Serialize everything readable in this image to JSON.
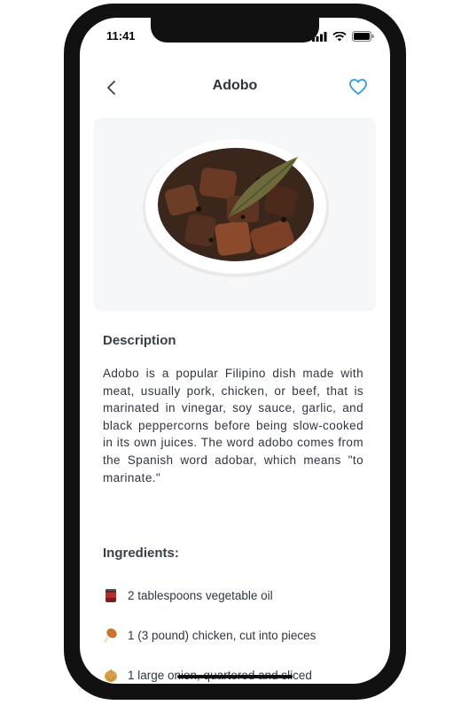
{
  "status": {
    "time": "11:41",
    "icons": [
      "signal-icon",
      "wifi-icon",
      "battery-icon"
    ]
  },
  "nav": {
    "title": "Adobo",
    "back_icon": "chevron-left-icon",
    "favorite_icon": "heart-outline-icon",
    "accent_color": "#2f9be8"
  },
  "hero": {
    "image": "adobo-dish-photo"
  },
  "description": {
    "heading": "Description",
    "body": "Adobo is a popular Filipino dish made with meat, usually pork, chicken, or beef, that is marinated in vinegar, soy sauce, garlic, and black peppercorns before being slow-cooked in its own juices. The word adobo comes from the Spanish word adobar, which means \"to marinate.\""
  },
  "ingredients": {
    "heading": "Ingredients:",
    "items": [
      {
        "icon": "oil-can-icon",
        "text": "2 tablespoons vegetable oil"
      },
      {
        "icon": "chicken-leg-icon",
        "text": "1 (3 pound) chicken, cut into pieces"
      },
      {
        "icon": "onion-icon",
        "text": "1 large onion, quartered and sliced"
      }
    ]
  }
}
